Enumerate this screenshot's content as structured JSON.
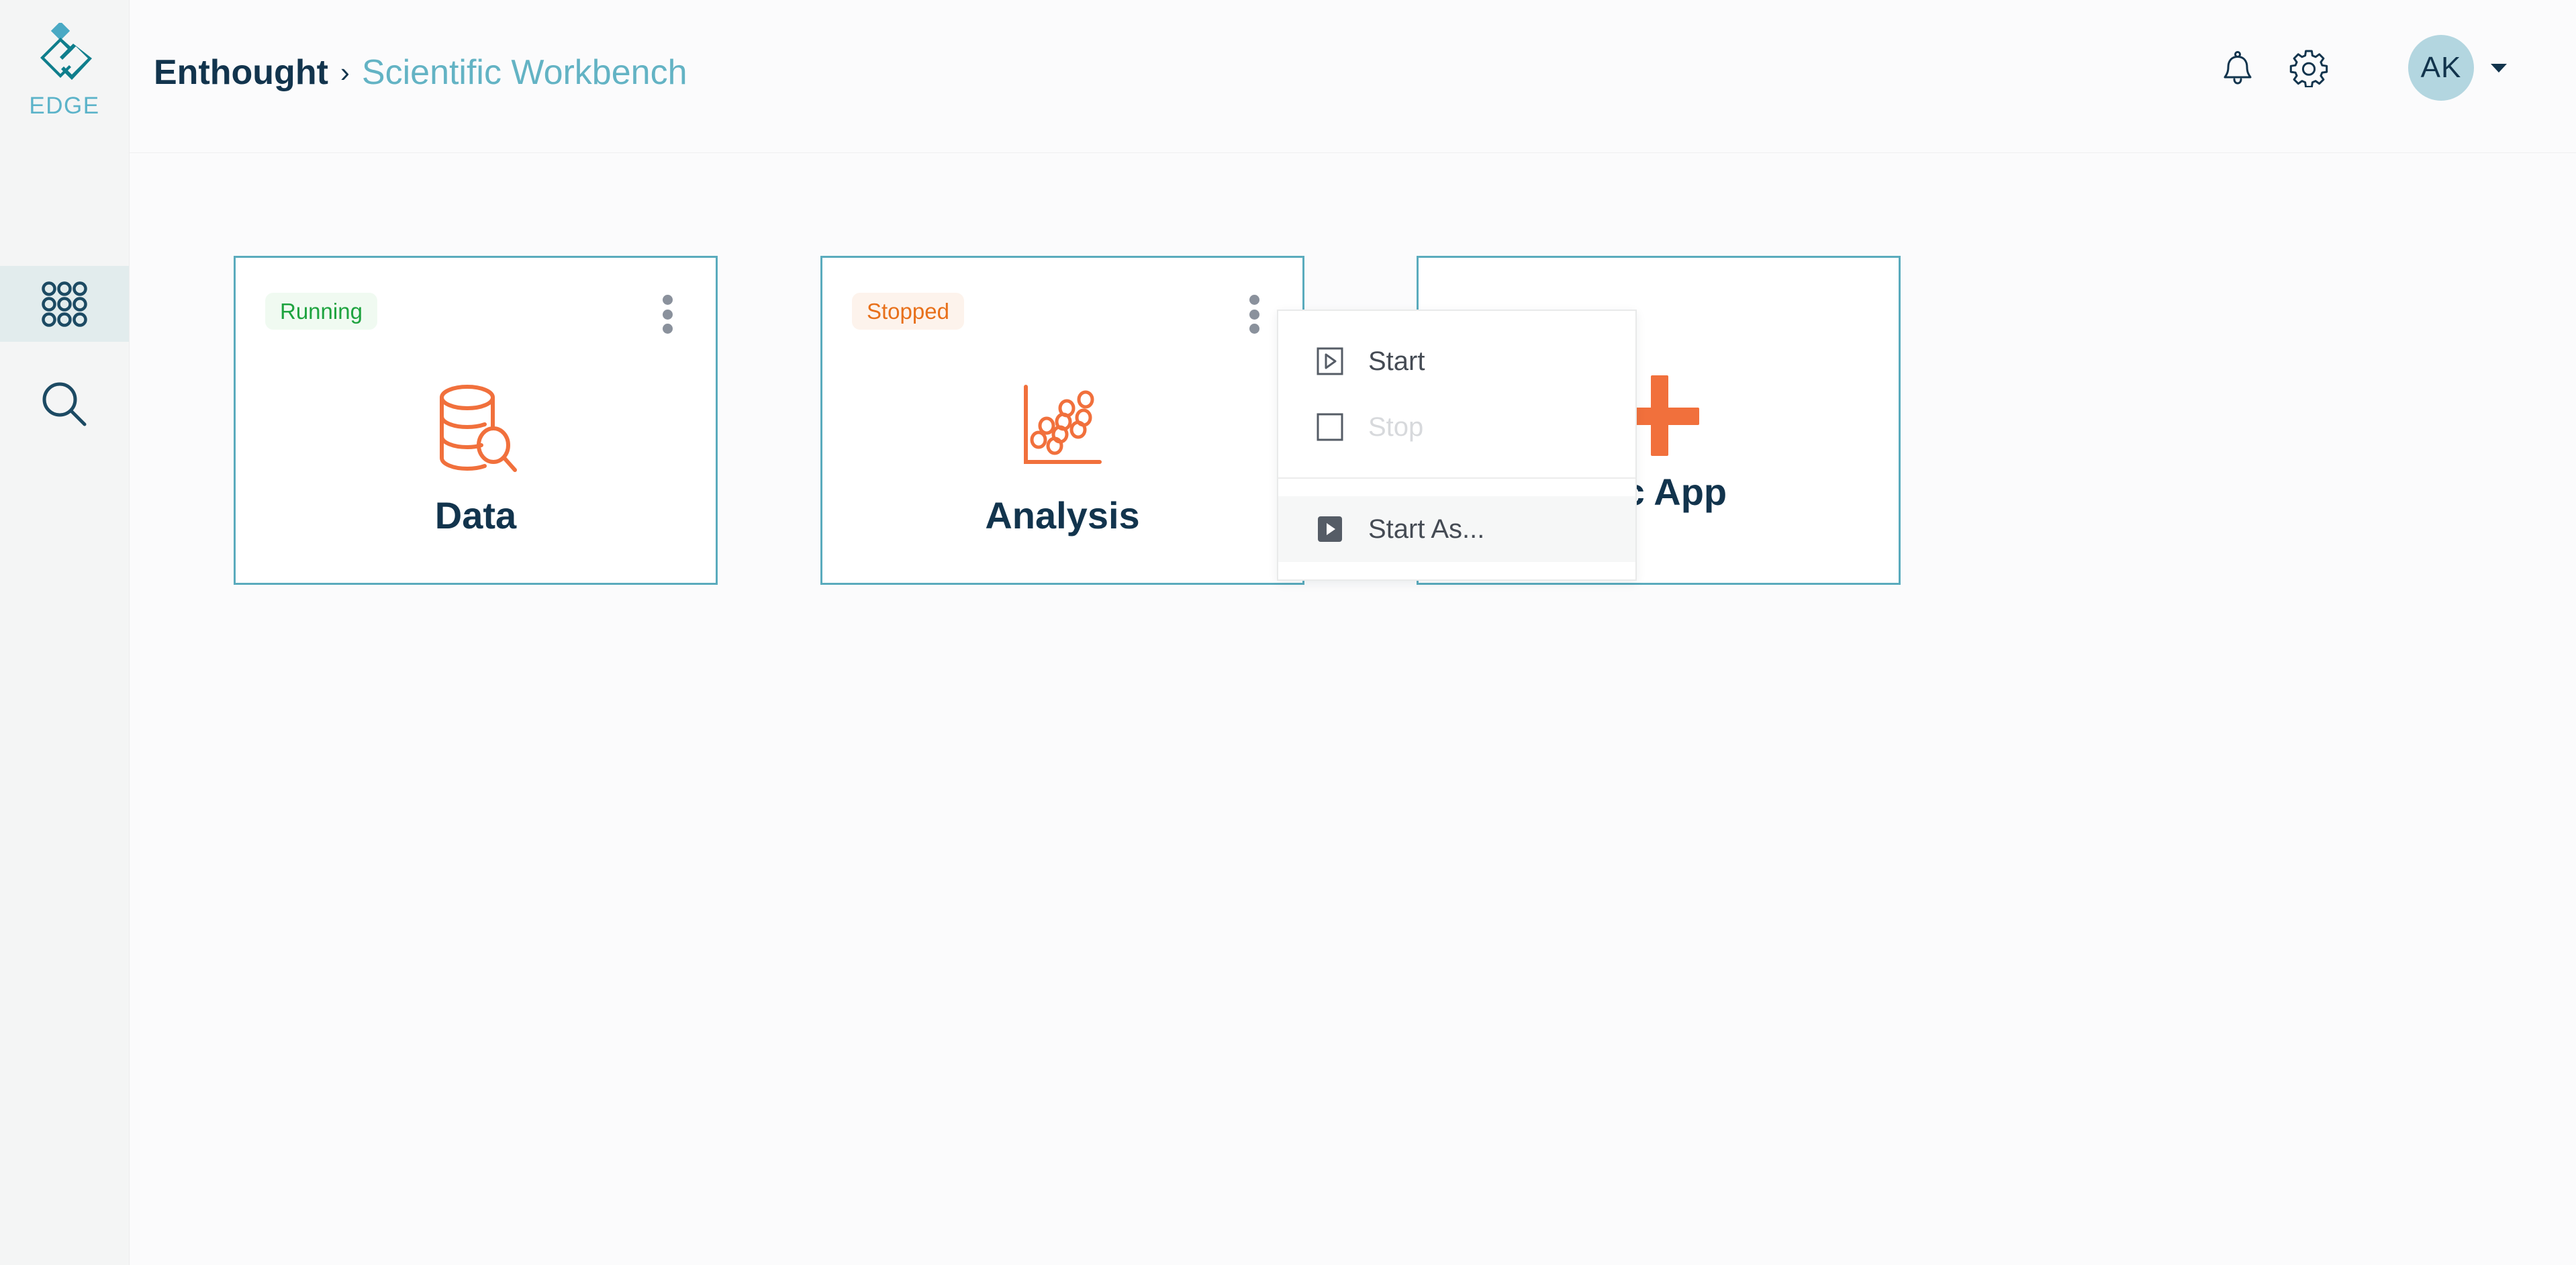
{
  "brand": {
    "logo_icon": "edge-diamond-logo-icon",
    "wordmark": "EDGE",
    "logo_color": "#0f7e8c",
    "logo_accent_color": "#4aa9c4",
    "wordmark_color": "#5bb3c9"
  },
  "sidebar": {
    "items": [
      {
        "name": "apps",
        "icon": "apps-grid-icon",
        "active": true
      },
      {
        "name": "search",
        "icon": "search-icon",
        "active": false
      }
    ]
  },
  "header": {
    "breadcrumb": {
      "root": "Enthought",
      "separator": "›",
      "current": "Scientific Workbench"
    },
    "actions": [
      {
        "name": "notifications",
        "icon": "bell-icon"
      },
      {
        "name": "settings",
        "icon": "gear-icon"
      }
    ],
    "user": {
      "initials": "AK",
      "avatar_color": "#b3d6e0",
      "chevron_icon": "chevron-down-icon"
    }
  },
  "cards": [
    {
      "id": "data",
      "status": "Running",
      "status_kind": "running",
      "label": "Data",
      "icon": "database-search-icon",
      "menu_icon": "kebab-menu-icon"
    },
    {
      "id": "analysis",
      "status": "Stopped",
      "status_kind": "stopped",
      "label": "Analysis",
      "icon": "scatter-plot-icon",
      "menu_icon": "kebab-menu-icon"
    },
    {
      "id": "new-app",
      "status": "",
      "status_kind": "none",
      "label": "ific App",
      "icon": "plus-icon",
      "menu_icon": ""
    }
  ],
  "context_menu": {
    "items": [
      {
        "label": "Start",
        "icon": "play-outline-icon",
        "disabled": false,
        "hovered": false
      },
      {
        "label": "Stop",
        "icon": "stop-square-icon",
        "disabled": true,
        "hovered": false
      },
      {
        "label": "Start As...",
        "icon": "play-filled-icon",
        "disabled": false,
        "hovered": true
      }
    ]
  },
  "colors": {
    "card_border": "#5aabbd",
    "accent_orange": "#f1703c",
    "navy_text": "#12344d",
    "teal_link": "#63b3c4",
    "status_running": "#1ea33f",
    "status_running_bg": "#f0faf1",
    "status_stopped": "#e8701a",
    "status_stopped_bg": "#fdf3ec",
    "sidebar_bg": "#f4f5f5",
    "sidebar_active_bg": "#e2eced",
    "page_bg": "#fbfbfc"
  }
}
